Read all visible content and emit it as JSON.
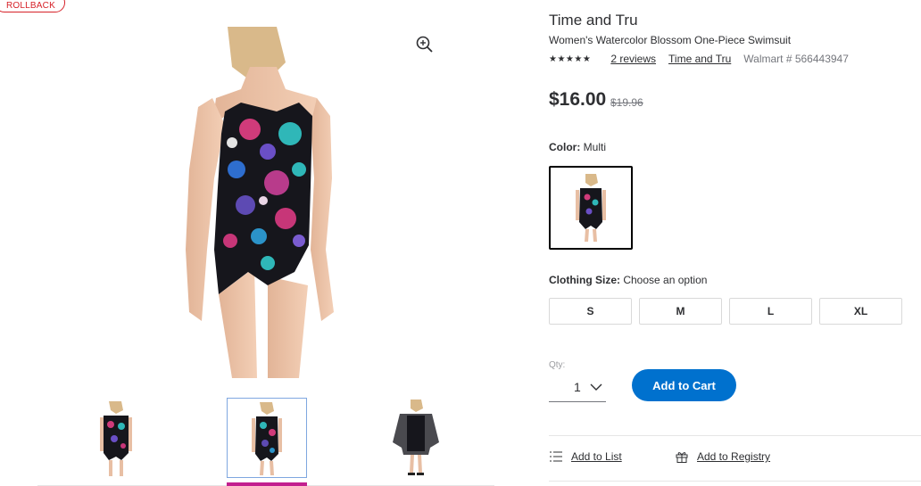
{
  "badge": {
    "rollback": "ROLLBACK"
  },
  "gallery": {
    "main_image": "swimsuit-floral-front",
    "zoom_icon": "zoom-in-icon",
    "thumbnails": [
      {
        "name": "swimsuit-floral-front"
      },
      {
        "name": "swimsuit-floral-alt",
        "selected": true
      },
      {
        "name": "swimsuit-with-coverup"
      }
    ]
  },
  "product": {
    "brand": "Time and Tru",
    "name": "Women's Watercolor Blossom One-Piece Swimsuit",
    "stars": "★★★★★",
    "reviews_label": "2 reviews",
    "brand_link": "Time and Tru",
    "walmart_id": "Walmart # 566443947",
    "price": "$16.00",
    "was_price": "$19.96"
  },
  "color": {
    "label": "Color:",
    "value": "Multi"
  },
  "size": {
    "label": "Clothing Size:",
    "value": "Choose an option",
    "options": [
      "S",
      "M",
      "L",
      "XL"
    ]
  },
  "quantity": {
    "label": "Qty:",
    "value": "1"
  },
  "cart": {
    "add_label": "Add to Cart"
  },
  "actions": {
    "add_to_list": "Add to List",
    "add_to_registry": "Add to Registry"
  },
  "colors": {
    "accent": "#0071ce",
    "rollback": "#d62128",
    "thumb_active": "#c21f8f"
  }
}
